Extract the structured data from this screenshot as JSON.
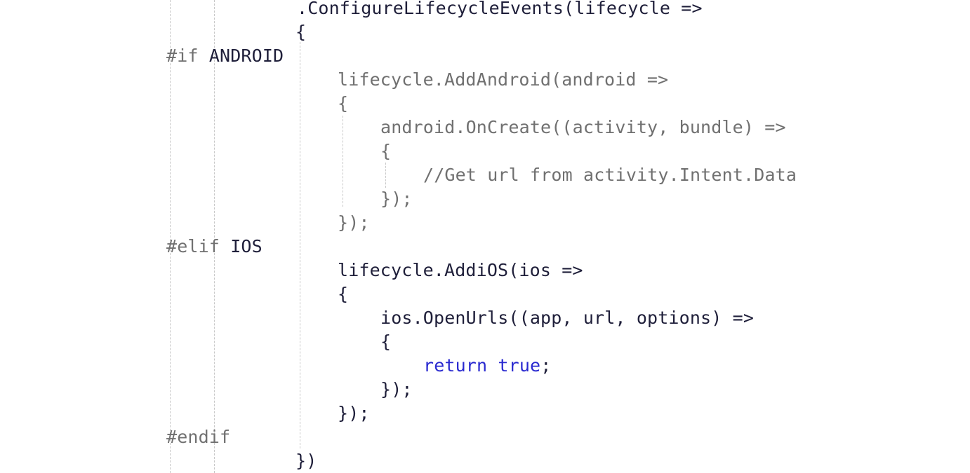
{
  "code": {
    "lines": [
      [
        {
          "text": ".ConfigureLifecycleEvents(lifecycle =>",
          "kind": "plain"
        }
      ],
      [
        {
          "text": "{",
          "kind": "plain"
        }
      ],
      [
        {
          "text": "#if",
          "kind": "dir"
        },
        {
          "text": " ",
          "kind": "gap"
        },
        {
          "text": "ANDROID",
          "kind": "plain"
        }
      ],
      [
        {
          "text": "lifecycle.AddAndroid(android =>",
          "kind": "dim"
        }
      ],
      [
        {
          "text": "{",
          "kind": "dim"
        }
      ],
      [
        {
          "text": "android.OnCreate((activity, bundle) =>",
          "kind": "dim"
        }
      ],
      [
        {
          "text": "{",
          "kind": "dim"
        }
      ],
      [
        {
          "text": "//Get url from activity.Intent.Data",
          "kind": "cm"
        }
      ],
      [
        {
          "text": "});",
          "kind": "dim"
        }
      ],
      [
        {
          "text": "});",
          "kind": "dim"
        }
      ],
      [
        {
          "text": "#elif",
          "kind": "dir"
        },
        {
          "text": " ",
          "kind": "gap"
        },
        {
          "text": "IOS",
          "kind": "plain"
        }
      ],
      [
        {
          "text": "lifecycle.AddiOS(ios =>",
          "kind": "plain"
        }
      ],
      [
        {
          "text": "{",
          "kind": "plain"
        }
      ],
      [
        {
          "text": "ios.OpenUrls((app, url, options) =>",
          "kind": "plain"
        }
      ],
      [
        {
          "text": "{",
          "kind": "plain"
        }
      ],
      [
        {
          "text": "return",
          "kind": "kw"
        },
        {
          "text": " ",
          "kind": "gap"
        },
        {
          "text": "true",
          "kind": "kw"
        },
        {
          "text": ";",
          "kind": "plain"
        }
      ],
      [
        {
          "text": "});",
          "kind": "plain"
        }
      ],
      [
        {
          "text": "});",
          "kind": "plain"
        }
      ],
      [
        {
          "text": "#endif",
          "kind": "dir"
        }
      ],
      [
        {
          "text": "})",
          "kind": "plain"
        }
      ]
    ]
  }
}
